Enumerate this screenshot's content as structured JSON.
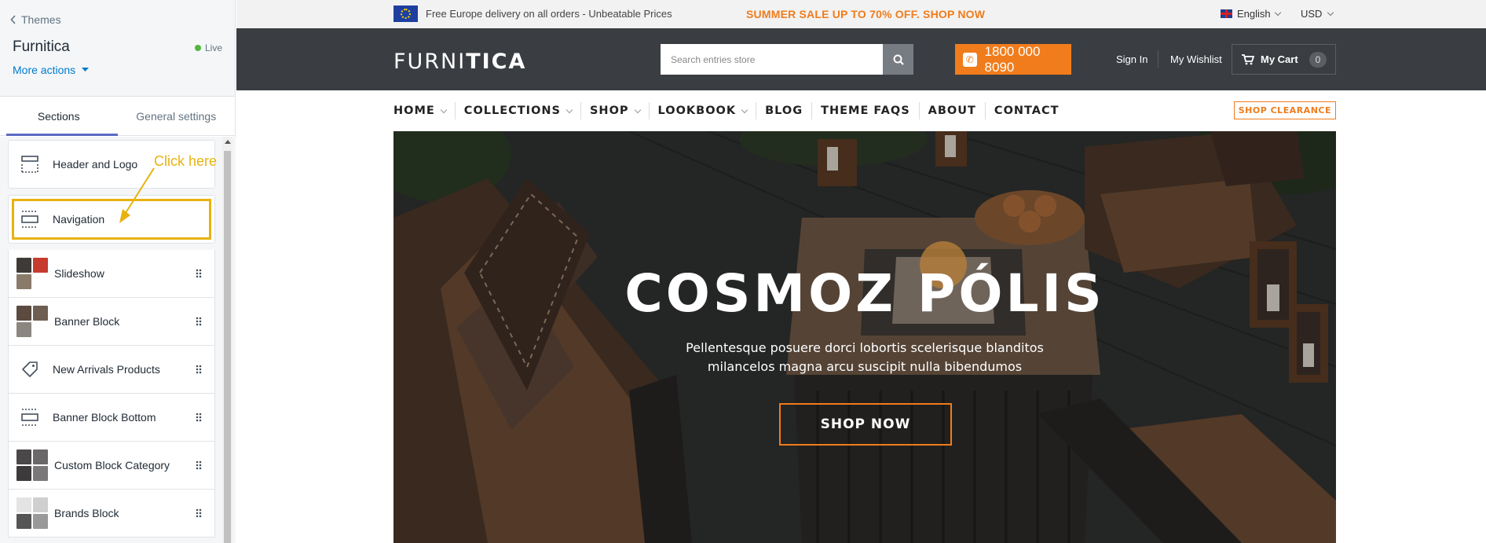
{
  "editor": {
    "back_label": "Themes",
    "theme_name": "Furnitica",
    "status": "Live",
    "more_actions": "More actions",
    "tabs": [
      {
        "label": "Sections",
        "active": true
      },
      {
        "label": "General settings",
        "active": false
      }
    ],
    "sections": [
      {
        "label": "Header and Logo",
        "icon": "header-layout-icon"
      },
      {
        "label": "Navigation",
        "icon": "navigation-layout-icon"
      },
      {
        "label": "Slideshow",
        "icon": "slideshow-thumbnail"
      },
      {
        "label": "Banner Block",
        "icon": "banner-thumbnail"
      },
      {
        "label": "New Arrivals Products",
        "icon": "tag-icon"
      },
      {
        "label": "Banner Block Bottom",
        "icon": "layout-icon"
      },
      {
        "label": "Custom Block Category",
        "icon": "category-thumbnail"
      },
      {
        "label": "Brands Block",
        "icon": "brands-thumbnail"
      }
    ],
    "callout": "Click here",
    "highlight_color": "#e8b20f"
  },
  "store": {
    "topbar": {
      "delivery": "Free Europe delivery on all orders - Unbeatable Prices",
      "sale": "SUMMER SALE UP TO 70% OFF. SHOP NOW",
      "language": "English",
      "currency": "USD"
    },
    "header": {
      "logo_light": "FURNI",
      "logo_bold": "TICA",
      "search_placeholder": "Search entries store",
      "phone": "1800 000 8090",
      "sign_in": "Sign In",
      "wishlist": "My Wishlist",
      "cart_label": "My Cart",
      "cart_count": "0"
    },
    "nav": [
      {
        "label": "HOME",
        "dropdown": true
      },
      {
        "label": "COLLECTIONS",
        "dropdown": true
      },
      {
        "label": "SHOP",
        "dropdown": true
      },
      {
        "label": "LOOKBOOK",
        "dropdown": true
      },
      {
        "label": "BLOG",
        "dropdown": false
      },
      {
        "label": "THEME FAQS",
        "dropdown": false
      },
      {
        "label": "ABOUT",
        "dropdown": false
      },
      {
        "label": "CONTACT",
        "dropdown": false
      }
    ],
    "clearance": "SHOP CLEARANCE",
    "hero": {
      "title": "COSMOZ PÓLIS",
      "subtitle": "Pellentesque posuere dorci lobortis scelerisque blanditos milancelos magna arcu suscipit nulla bibendumos",
      "button": "SHOP NOW"
    },
    "accent_color": "#f07c1b",
    "header_bg": "#3a3d42"
  }
}
